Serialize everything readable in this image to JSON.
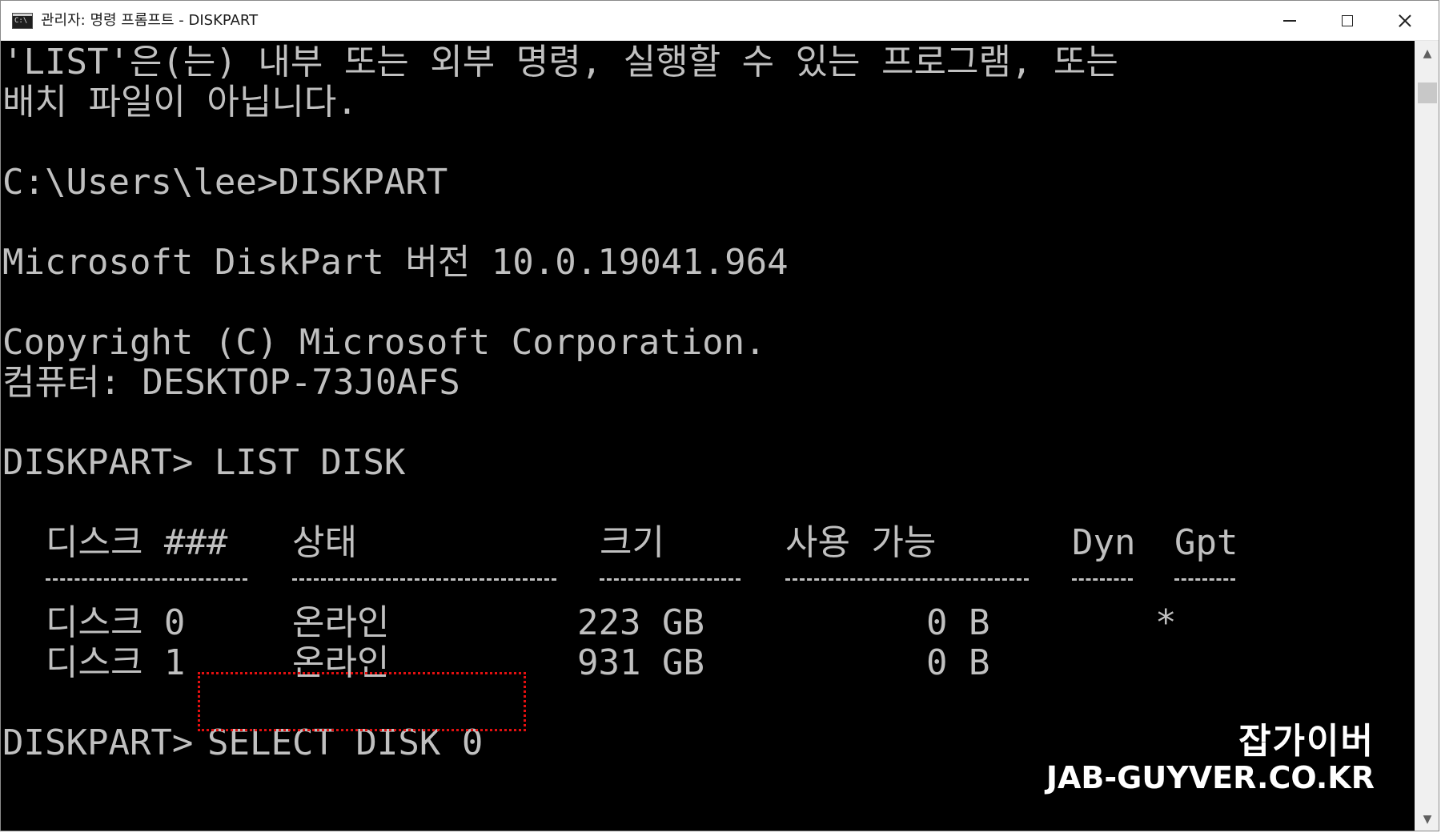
{
  "window": {
    "title": "관리자: 명령 프롬프트 - DISKPART",
    "icon": "cmd-icon",
    "controls": {
      "minimize": "minimize-icon",
      "maximize": "maximize-icon",
      "close": "close-icon"
    }
  },
  "console": {
    "lines": [
      "'LIST'은(는) 내부 또는 외부 명령, 실행할 수 있는 프로그램, 또는",
      "배치 파일이 아닙니다.",
      "C:\\Users\\lee>DISKPART",
      "Microsoft DiskPart 버전 10.0.19041.964",
      "Copyright (C) Microsoft Corporation.",
      "컴퓨터: DESKTOP-73J0AFS",
      "DISKPART> LIST DISK",
      "DISKPART> "
    ],
    "table": {
      "headers": [
        "디스크 ###",
        "상태",
        "크기",
        "사용 가능",
        "Dyn",
        "Gpt"
      ],
      "separators": [
        "----------",
        "-------------",
        "-------",
        "------------",
        "---",
        "---"
      ],
      "rows": [
        [
          "디스크 0",
          "온라인",
          "223 GB",
          "0 B",
          "",
          "*"
        ],
        [
          "디스크 1",
          "온라인",
          "931 GB",
          "0 B",
          "",
          ""
        ]
      ]
    },
    "current_command": "SELECT DISK 0",
    "text_color": "#c0c0c0",
    "background_color": "#000000",
    "highlight_color": "#e41010"
  },
  "watermark": {
    "korean": "잡가이버",
    "url": "JAB-GUYVER.CO.KR"
  }
}
